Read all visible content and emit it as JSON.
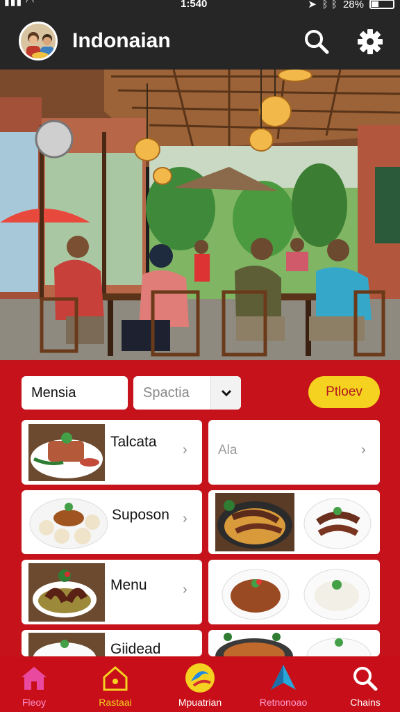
{
  "status_bar": {
    "time": "1:540",
    "battery": "28%"
  },
  "header": {
    "title": "Indonaian",
    "avatar_icon": "family-avatar",
    "search_icon": "search-icon",
    "settings_icon": "gear-icon"
  },
  "hero": {
    "scene": "restaurant-interior-photo"
  },
  "filters": {
    "text_value": "Mensia",
    "select_placeholder": "Spactia",
    "action_label": "Ptloev"
  },
  "menu_cards": [
    {
      "label": "Talcata",
      "dish": "beef-with-greens"
    },
    {
      "label": "Ala",
      "dish": ""
    },
    {
      "label": "Suposon",
      "dish": "dumplings-plate"
    },
    {
      "label": "",
      "dish": "noodles-and-eggplant"
    },
    {
      "label": "Menu",
      "dish": "eggplant-curry"
    },
    {
      "label": "",
      "dish": "fried-noodles-and-rice"
    },
    {
      "label": "Giidead",
      "dish": "rice-plates"
    }
  ],
  "bottom_nav": [
    {
      "label": "Fleoy",
      "icon": "home-icon",
      "color": "#e94aa0"
    },
    {
      "label": "Rastaai",
      "icon": "house-outline-icon",
      "color": "#f5d21f"
    },
    {
      "label": "Mpuatrian",
      "icon": "chef-badge-icon",
      "color": "#f5d21f"
    },
    {
      "label": "Retnonoao",
      "icon": "navigation-icon",
      "color": "#ff9fd0"
    },
    {
      "label": "Chains",
      "icon": "search-icon",
      "color": "#ffffff"
    }
  ],
  "colors": {
    "header_bg": "#262626",
    "panel_red": "#c5121b",
    "accent_yellow": "#f5d21f"
  }
}
